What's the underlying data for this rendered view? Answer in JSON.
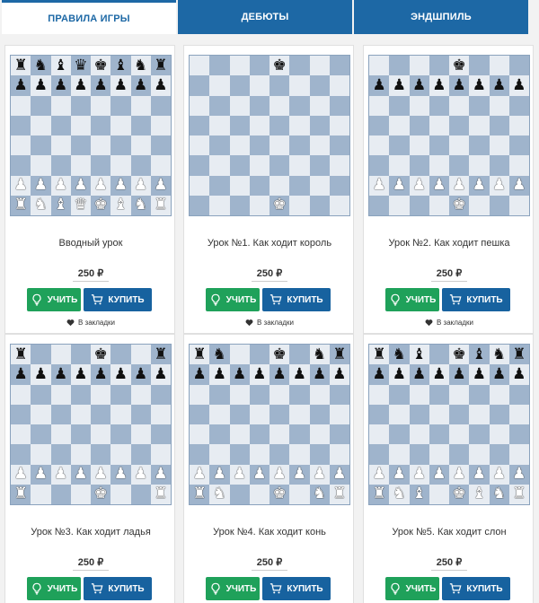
{
  "tabs": [
    {
      "label": "Правила игры",
      "active": true
    },
    {
      "label": "Дебюты",
      "active": false
    },
    {
      "label": "Эндшпиль",
      "active": false
    }
  ],
  "common": {
    "learn_label": "УЧИТЬ",
    "buy_label": "КУПИТЬ",
    "bookmark_label": "В закладки",
    "currency": "₽"
  },
  "colors": {
    "tab_bg": "#1d68a5",
    "learn_btn": "#1fa15a",
    "buy_btn": "#17629f"
  },
  "lessons": [
    {
      "title": "Вводный урок",
      "price": "250 ₽",
      "board": [
        "rnbqkbnr",
        "pppppppp",
        "........",
        "........",
        "........",
        "........",
        "PPPPPPPP",
        "RNBQKBNR"
      ]
    },
    {
      "title": "Урок №1. Как ходит король",
      "price": "250 ₽",
      "board": [
        "....k...",
        "........",
        "........",
        "........",
        "........",
        "........",
        "........",
        "....K..."
      ]
    },
    {
      "title": "Урок №2. Как ходит пешка",
      "price": "250 ₽",
      "board": [
        "....k...",
        "pppppppp",
        "........",
        "........",
        "........",
        "........",
        "PPPPPPPP",
        "....K..."
      ]
    },
    {
      "title": "Урок №3. Как ходит ладья",
      "price": "250 ₽",
      "board": [
        "r...k..r",
        "pppppppp",
        "........",
        "........",
        "........",
        "........",
        "PPPPPPPP",
        "R...K..R"
      ]
    },
    {
      "title": "Урок №4. Как ходит конь",
      "price": "250 ₽",
      "board": [
        "rn..k.nr",
        "pppppppp",
        "........",
        "........",
        "........",
        "........",
        "PPPPPPPP",
        "RN..K.NR"
      ]
    },
    {
      "title": "Урок №5. Как ходит слон",
      "price": "250 ₽",
      "board": [
        "rnb.kbnr",
        "pppppppp",
        "........",
        "........",
        "........",
        "........",
        "PPPPPPPP",
        "RNB.KBNR"
      ]
    }
  ]
}
